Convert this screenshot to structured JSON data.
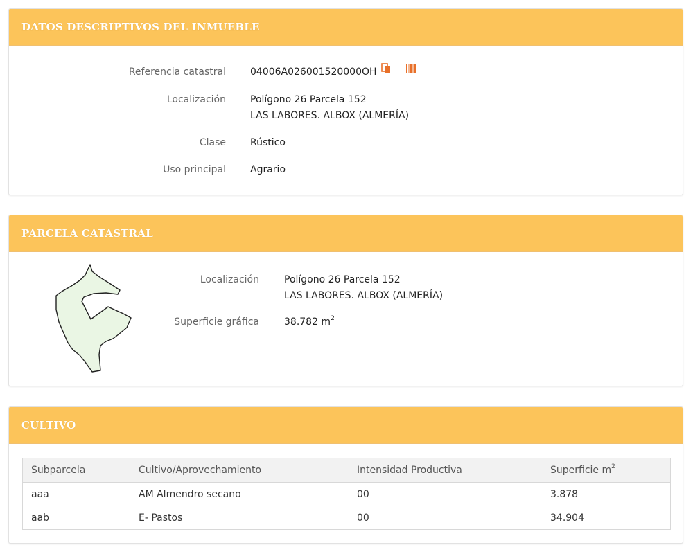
{
  "datos": {
    "title": "DATOS DESCRIPTIVOS DEL INMUEBLE",
    "ref_label": "Referencia catastral",
    "ref_value": "04006A026001520000OH",
    "loc_label": "Localización",
    "loc_line1": "Polígono 26 Parcela 152",
    "loc_line2": "LAS LABORES. ALBOX (ALMERÍA)",
    "clase_label": "Clase",
    "clase_value": "Rústico",
    "uso_label": "Uso principal",
    "uso_value": "Agrario"
  },
  "parcela": {
    "title": "PARCELA CATASTRAL",
    "loc_label": "Localización",
    "loc_line1": "Polígono 26 Parcela 152",
    "loc_line2": "LAS LABORES. ALBOX (ALMERÍA)",
    "sup_label": "Superficie gráfica",
    "sup_value": "38.782 m",
    "sup_unit_exp": "2"
  },
  "cultivo": {
    "title": "CULTIVO",
    "headers": [
      "Subparcela",
      "Cultivo/Aprovechamiento",
      "Intensidad Productiva",
      "Superficie m"
    ],
    "header_exp": "2",
    "rows": [
      [
        "aaa",
        "AM Almendro secano",
        "00",
        "3.878"
      ],
      [
        "aab",
        "E- Pastos",
        "00",
        "34.904"
      ]
    ]
  },
  "colors": {
    "header_bg": "#fcc45a",
    "icon_orange": "#e8702a",
    "parcel_fill": "#eaf6e4"
  },
  "icons": [
    "copy-icon",
    "barcode-icon"
  ]
}
